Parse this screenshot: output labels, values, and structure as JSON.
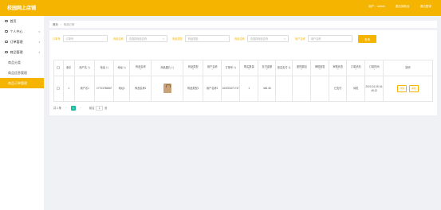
{
  "header": {
    "title": "校园网上店铺",
    "user": "用户：admin",
    "links": [
      "退出到前台",
      "退出登录"
    ]
  },
  "sidebar": {
    "items": [
      {
        "label": "首页",
        "icon": "home-icon"
      },
      {
        "label": "个人中心",
        "icon": "user-icon",
        "chevron": "▾"
      },
      {
        "label": "订单管理",
        "icon": "order-icon",
        "chevron": "▾"
      },
      {
        "label": "商品管理",
        "icon": "goods-icon",
        "chevron": "▾"
      }
    ],
    "subitems": [
      "商品分类",
      "商品信息管理",
      "商品订单管理"
    ]
  },
  "breadcrumb": {
    "home": "首页",
    "sep": "/",
    "current": "商品订单"
  },
  "filters": [
    {
      "label": "订单号",
      "placeholder": "订单号"
    },
    {
      "label": "商品名称",
      "placeholder": "请选择商品名称"
    },
    {
      "label": "商品类型",
      "placeholder": "商品类型"
    },
    {
      "label": "商品名称",
      "placeholder": "请选择商品名称"
    },
    {
      "label": "用户名称",
      "placeholder": "用户名称"
    }
  ],
  "search_button": "查询",
  "table": {
    "headers": [
      "",
      "索引",
      "用户名",
      "电话",
      "地址",
      "商品名称",
      "商品图片",
      "商品类型",
      "用户名称",
      "订单号",
      "购买数量",
      "支付金额",
      "是否支付",
      "退货原因",
      "审核回复",
      "审核状态",
      "订单状态",
      "订单时间",
      "操作"
    ],
    "rows": [
      {
        "index": "1",
        "username": "用户名1",
        "phone": "17703786867",
        "address": "地址1",
        "product": "商品名称1",
        "type": "商品类型1",
        "user_name": "用户名称1",
        "order_no": "164923471737",
        "qty": "1",
        "amount": "448.48",
        "paid": "",
        "reason": "",
        "reply": "",
        "audit_status": "已支付",
        "order_status": "待发",
        "time": "2022-04-06 16:45:12",
        "actions": [
          "详情",
          "审核"
        ]
      }
    ]
  },
  "pager": {
    "total": "共 1 条",
    "prev": "‹",
    "current": "1",
    "next": "›",
    "goto_label": "前往",
    "goto_value": "1",
    "goto_suffix": "页"
  },
  "colors": {
    "accent": "#f5b400",
    "pager_current": "#1abc9c"
  }
}
